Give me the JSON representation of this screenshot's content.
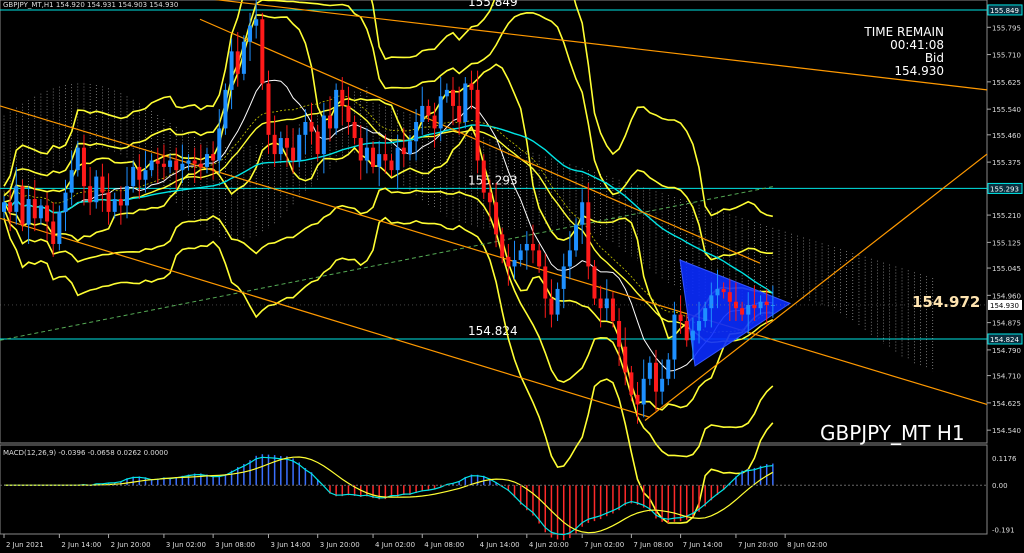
{
  "chart_data": {
    "type": "candlestick",
    "symbol_header": "GBPJPY_MT,H1  154.920 154.931 154.903 154.930",
    "watermark": "GBPJPY_MT H1",
    "info": {
      "line1": "TIME REMAIN",
      "line2": "00:41:08",
      "line3": "Bid",
      "line4": "154.930"
    },
    "big_price": "154.972",
    "current_price": "154.930",
    "price_axis": {
      "min": 154.5,
      "max": 155.88,
      "ticks": [
        "155.795",
        "155.710",
        "155.625",
        "155.540",
        "155.460",
        "155.375",
        "155.290",
        "155.210",
        "155.125",
        "155.045",
        "154.960",
        "154.875",
        "154.790",
        "154.710",
        "154.625",
        "154.540"
      ]
    },
    "hlines": [
      {
        "value": 155.849,
        "label": "155.849"
      },
      {
        "value": 155.293,
        "label": "155.293"
      },
      {
        "value": 154.824,
        "label": "154.824"
      }
    ],
    "time_axis": {
      "count": 126,
      "labels": [
        {
          "i": 0,
          "text": "2 Jun 2021"
        },
        {
          "i": 9,
          "text": "2 Jun 14:00"
        },
        {
          "i": 17,
          "text": "2 Jun 20:00"
        },
        {
          "i": 26,
          "text": "3 Jun 02:00"
        },
        {
          "i": 34,
          "text": "3 Jun 08:00"
        },
        {
          "i": 43,
          "text": "3 Jun 14:00"
        },
        {
          "i": 51,
          "text": "3 Jun 20:00"
        },
        {
          "i": 60,
          "text": "4 Jun 02:00"
        },
        {
          "i": 68,
          "text": "4 Jun 08:00"
        },
        {
          "i": 77,
          "text": "4 Jun 14:00"
        },
        {
          "i": 85,
          "text": "4 Jun 20:00"
        },
        {
          "i": 94,
          "text": "7 Jun 02:00"
        },
        {
          "i": 102,
          "text": "7 Jun 08:00"
        },
        {
          "i": 110,
          "text": "7 Jun 14:00"
        },
        {
          "i": 119,
          "text": "7 Jun 20:00"
        },
        {
          "i": 127,
          "text": "8 Jun 02:00"
        }
      ]
    },
    "close": [
      155.25,
      155.22,
      155.3,
      155.18,
      155.26,
      155.2,
      155.24,
      155.19,
      155.12,
      155.22,
      155.28,
      155.35,
      155.42,
      155.3,
      155.25,
      155.33,
      155.28,
      155.22,
      155.26,
      155.24,
      155.3,
      155.36,
      155.32,
      155.35,
      155.38,
      155.37,
      155.36,
      155.38,
      155.35,
      155.37,
      155.38,
      155.37,
      155.36,
      155.4,
      155.38,
      155.48,
      155.6,
      155.72,
      155.65,
      155.75,
      155.8,
      155.82,
      155.62,
      155.46,
      155.4,
      155.45,
      155.42,
      155.38,
      155.46,
      155.5,
      155.47,
      155.4,
      155.52,
      155.48,
      155.6,
      155.55,
      155.5,
      155.45,
      155.38,
      155.42,
      155.36,
      155.4,
      155.38,
      155.35,
      155.42,
      155.4,
      155.44,
      155.5,
      155.55,
      155.52,
      155.48,
      155.58,
      155.6,
      155.55,
      155.5,
      155.62,
      155.6,
      155.38,
      155.28,
      155.25,
      155.15,
      155.08,
      155.05,
      155.07,
      155.1,
      155.12,
      155.1,
      155.05,
      154.95,
      154.9,
      154.98,
      155.05,
      155.1,
      155.18,
      155.25,
      155.05,
      154.95,
      154.92,
      154.95,
      154.88,
      154.8,
      154.72,
      154.65,
      154.62,
      154.7,
      154.75,
      154.66,
      154.7,
      154.76,
      154.9,
      154.88,
      154.82,
      154.85,
      154.88,
      154.92,
      154.96,
      154.98,
      154.97,
      154.94,
      154.92,
      154.9,
      154.93,
      154.92,
      154.94,
      154.93,
      154.93
    ],
    "macd_panel": {
      "label": "MACD(12,26,9) -0.0396 -0.0658 0.0262 0.0000",
      "ticks": [
        {
          "v": 0.1176,
          "text": "0.1176"
        },
        {
          "v": 0.0,
          "text": "0.00"
        },
        {
          "v": -0.191,
          "text": "-0.191"
        }
      ],
      "range": [
        -0.21,
        0.13
      ]
    },
    "colors": {
      "bull": "#1e90ff",
      "bear": "#ff1a1a",
      "envelope": "#ffff33",
      "channel": "#ff9900",
      "cyan": "#00e5e5",
      "triangle": "#0a2cff"
    }
  }
}
